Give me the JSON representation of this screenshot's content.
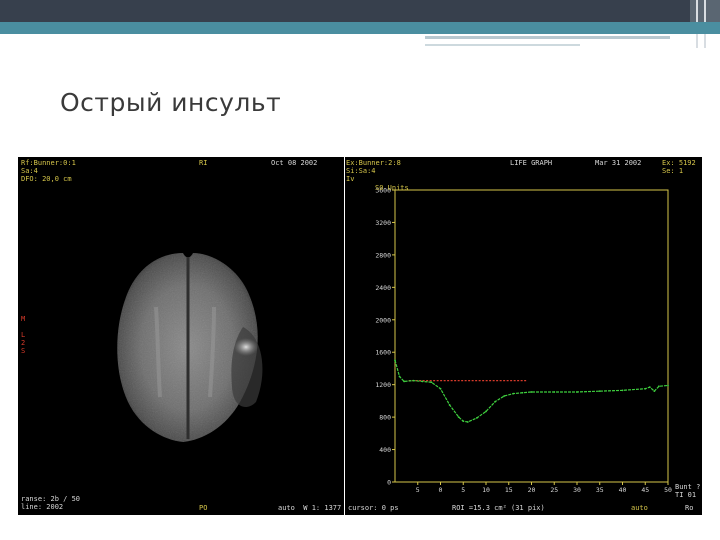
{
  "slide": {
    "title": "Острый инсульт",
    "colors": {
      "header": "#37404d",
      "accent": "#4a8ea0"
    }
  },
  "left_panel": {
    "top_left": "Rf:Bunner:0:1\nSa:4\nDFO: 20,0 cm",
    "top_mid": "RI",
    "top_right": "Oct 08 2002",
    "left_marks": "M\n\nL\n2\nS",
    "bottom_left": "ranse: 2b / 50\nline: 2002",
    "bottom_mid": "PO",
    "bottom_right": "auto  W 1: 1377"
  },
  "right_panel": {
    "top_left": "Ex:Bunner:2:8\nSi:Sa:4\nIv",
    "top_mid": "LIFE GRAPH",
    "top_date": "Mar 31 2002",
    "top_right": "Ex: 5192\nSe: 1",
    "bottom_left": "cursor: 0 ps",
    "bottom_mid": "ROI =15.3 cm² (31 pix)",
    "bottom_right_auto": "auto",
    "bottom_right": "Ro",
    "right_edge_text": "Bunt ?\nTI 01"
  },
  "chart_data": {
    "type": "line",
    "ylabel": "S0 Units",
    "ylim": [
      0,
      3600
    ],
    "xlim": [
      -10,
      50
    ],
    "yticks": [
      0,
      400,
      800,
      1200,
      1600,
      2000,
      2400,
      2800,
      3200,
      3600
    ],
    "xticks": [
      -5,
      0,
      5,
      10,
      15,
      20,
      25,
      30,
      35,
      40,
      45,
      50
    ],
    "xtick_labels": [
      "5",
      "0",
      "5",
      "10",
      "15",
      "20",
      "25",
      "30",
      "35",
      "40",
      "45",
      "50"
    ],
    "baseline": {
      "value": 1250,
      "x_from": -7,
      "x_to": 19,
      "color": "#d63a2a"
    },
    "series": [
      {
        "color": "#3ecf3e",
        "x": [
          -10,
          -9,
          -8,
          -6,
          -4,
          -2,
          0,
          2,
          4,
          5,
          6,
          8,
          10,
          12,
          14,
          16,
          18,
          20,
          25,
          30,
          35,
          40,
          45,
          46,
          47,
          48,
          50
        ],
        "y": [
          1500,
          1300,
          1240,
          1250,
          1240,
          1230,
          1150,
          950,
          800,
          750,
          740,
          790,
          870,
          990,
          1060,
          1090,
          1100,
          1110,
          1110,
          1110,
          1120,
          1130,
          1150,
          1170,
          1120,
          1180,
          1190
        ]
      }
    ]
  }
}
